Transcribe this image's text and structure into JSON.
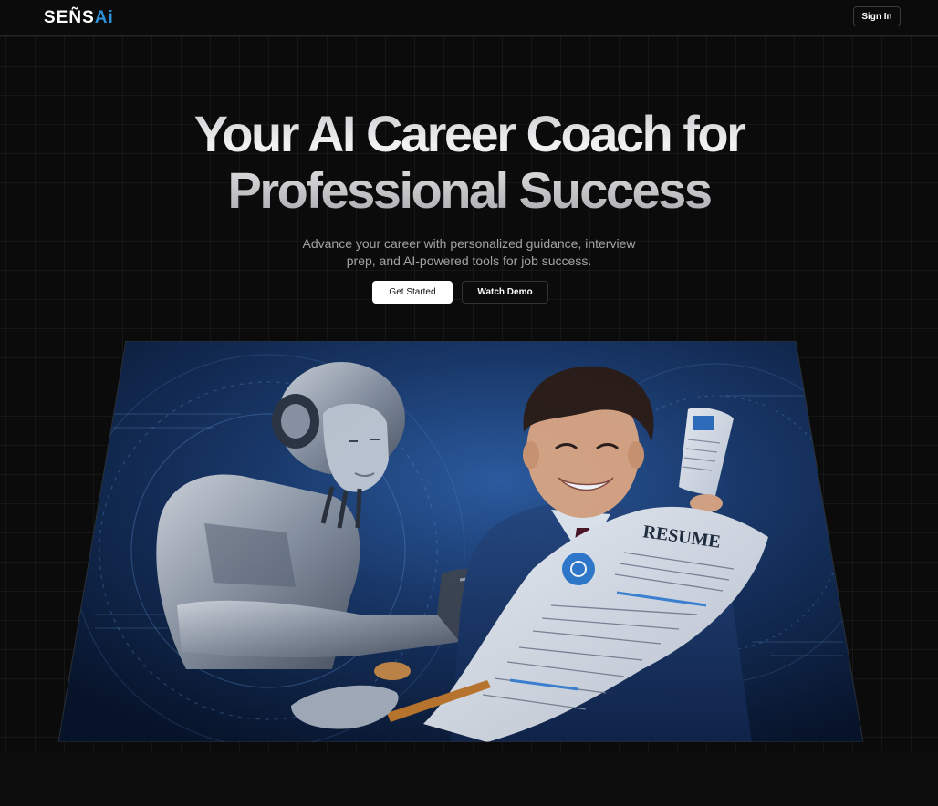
{
  "header": {
    "logo_main": "SEÑS",
    "logo_accent": "Ai",
    "signin_label": "Sign In"
  },
  "hero": {
    "title_line1": "Your AI Career Coach for",
    "title_line2": "Professional Success",
    "subtitle": "Advance your career with personalized guidance, interview prep, and AI-powered tools for job success.",
    "primary_button": "Get Started",
    "secondary_button": "Watch Demo"
  },
  "image": {
    "resume_heading": "RESUME"
  },
  "colors": {
    "background": "#0b0b0c",
    "accent": "#2f8fd6",
    "image_blue": "#1d3f73"
  }
}
